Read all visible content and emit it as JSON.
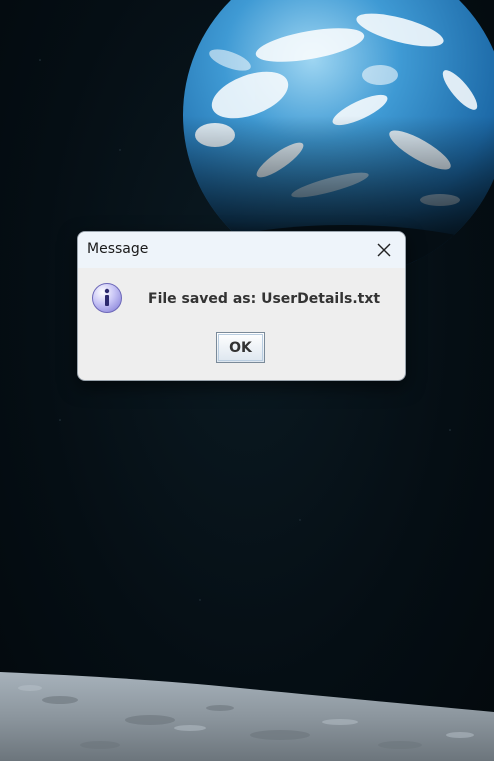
{
  "dialog": {
    "title": "Message",
    "message": "File saved as: UserDetails.txt",
    "ok_label": "OK"
  },
  "icons": {
    "close": "close-icon",
    "info": "info-icon"
  },
  "colors": {
    "space": "#050e14",
    "earth_ocean": "#2e8fd0",
    "moon_surface": "#8f9aa3",
    "dialog_bg": "#eeeeee",
    "titlebar_bg": "#eef4fa",
    "info_icon": "#b7b3f0"
  }
}
